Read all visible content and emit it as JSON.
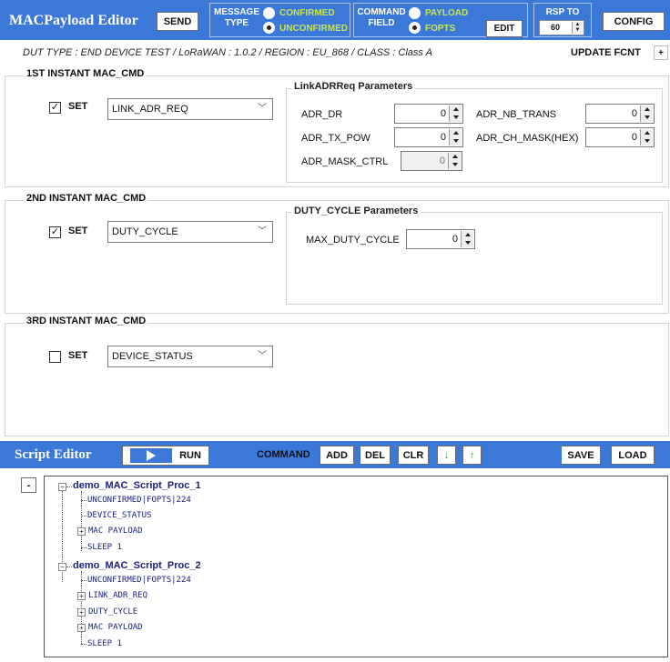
{
  "app": {
    "title": "MACPayload Editor",
    "send_label": "SEND",
    "message_type": {
      "label_line1": "MESSAGE",
      "label_line2": "TYPE",
      "options": [
        "CONFIRMED",
        "UNCONFIRMED"
      ],
      "selected": "UNCONFIRMED"
    },
    "command_field": {
      "label_line1": "COMMAND",
      "label_line2": "FIELD",
      "options": [
        "PAYLOAD",
        "FOPTS"
      ],
      "selected": "FOPTS"
    },
    "edit_label": "EDIT",
    "rsp_to": {
      "label": "RSP TO",
      "value": "60"
    },
    "config_label": "CONFIG",
    "dut_info": "DUT TYPE : END DEVICE TEST / LoRaWAN : 1.0.2 / REGION : EU_868 / CLASS : Class A",
    "update_fcnt_label": "UPDATE FCNT",
    "plus_label": "+"
  },
  "sections": [
    {
      "title": "1ST INSTANT MAC_CMD",
      "set_label": "SET",
      "checked": true,
      "command": "LINK_ADR_REQ",
      "params_title": "LinkADRReq Parameters",
      "params": [
        {
          "label": "ADR_DR",
          "value": "0",
          "enabled": true
        },
        {
          "label": "ADR_NB_TRANS",
          "value": "0",
          "enabled": true
        },
        {
          "label": "ADR_TX_POW",
          "value": "0",
          "enabled": true
        },
        {
          "label": "ADR_CH_MASK(HEX)",
          "value": "0",
          "enabled": true
        },
        {
          "label": "ADR_MASK_CTRL",
          "value": "0",
          "enabled": false
        }
      ]
    },
    {
      "title": "2ND INSTANT MAC_CMD",
      "set_label": "SET",
      "checked": true,
      "command": "DUTY_CYCLE",
      "params_title": "DUTY_CYCLE Parameters",
      "params": [
        {
          "label": "MAX_DUTY_CYCLE",
          "value": "0",
          "enabled": true
        }
      ]
    },
    {
      "title": "3RD INSTANT MAC_CMD",
      "set_label": "SET",
      "checked": false,
      "command": "DEVICE_STATUS"
    }
  ],
  "script_editor": {
    "title": "Script Editor",
    "run_label": "RUN",
    "command_label": "COMMAND",
    "add_label": "ADD",
    "del_label": "DEL",
    "clr_label": "CLR",
    "down_label": "↓",
    "up_label": "↑",
    "save_label": "SAVE",
    "load_label": "LOAD",
    "collapse_label": "-",
    "tree": [
      {
        "name": "demo_MAC_Script_Proc_1",
        "children": [
          {
            "label": "UNCONFIRMED|FOPTS|224",
            "expandable": false
          },
          {
            "label": "DEVICE_STATUS",
            "expandable": false
          },
          {
            "label": "MAC PAYLOAD",
            "expandable": true
          },
          {
            "label": "SLEEP 1",
            "expandable": false
          }
        ]
      },
      {
        "name": "demo_MAC_Script_Proc_2",
        "children": [
          {
            "label": "UNCONFIRMED|FOPTS|224",
            "expandable": false
          },
          {
            "label": "LINK_ADR_REQ",
            "expandable": true
          },
          {
            "label": "DUTY_CYCLE",
            "expandable": true
          },
          {
            "label": "MAC PAYLOAD",
            "expandable": true
          },
          {
            "label": "SLEEP 1",
            "expandable": false
          }
        ]
      }
    ]
  },
  "colors": {
    "header_bg": "#3c78d8",
    "radio_text": "#c8e25a",
    "tree_text": "#1a237e"
  },
  "icons": {
    "run": "play-icon",
    "dropdown": "chevron-down-icon",
    "check": "checkmark-icon"
  }
}
